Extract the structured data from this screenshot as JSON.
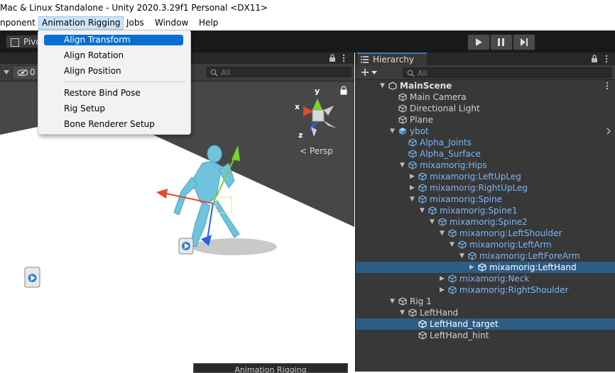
{
  "window": {
    "title": "Mac & Linux Standalone - Unity 2020.3.29f1 Personal <DX11>"
  },
  "menubar": {
    "items": [
      {
        "label": "nponent"
      },
      {
        "label": "Animation Rigging"
      },
      {
        "label": "Jobs"
      },
      {
        "label": "Window"
      },
      {
        "label": "Help"
      }
    ]
  },
  "toolbar": {
    "pivot_label": "Pivo"
  },
  "scene": {
    "layers_count": "0",
    "search_placeholder": "All",
    "persp_label": "Persp",
    "gizmo_axes": {
      "x": "x",
      "y": "y",
      "z": "z"
    }
  },
  "dropdown": {
    "items": [
      {
        "label": "Align Transform"
      },
      {
        "label": "Align Rotation"
      },
      {
        "label": "Align Position"
      },
      {
        "label": "Restore Bind Pose"
      },
      {
        "label": "Rig Setup"
      },
      {
        "label": "Bone Renderer Setup"
      }
    ]
  },
  "hierarchy": {
    "tab_label": "Hierarchy",
    "search_placeholder": "All",
    "rows": [
      {
        "label": "MainScene",
        "depth": 0,
        "arrow": "down",
        "style": "scene",
        "selected": false
      },
      {
        "label": "Main Camera",
        "depth": 1,
        "arrow": "",
        "style": "normal",
        "selected": false
      },
      {
        "label": "Directional Light",
        "depth": 1,
        "arrow": "",
        "style": "normal",
        "selected": false
      },
      {
        "label": "Plane",
        "depth": 1,
        "arrow": "",
        "style": "normal",
        "selected": false
      },
      {
        "label": "ybot",
        "depth": 1,
        "arrow": "down",
        "style": "blue",
        "selected": false
      },
      {
        "label": "Alpha_Joints",
        "depth": 2,
        "arrow": "",
        "style": "blue",
        "selected": false
      },
      {
        "label": "Alpha_Surface",
        "depth": 2,
        "arrow": "",
        "style": "blue",
        "selected": false
      },
      {
        "label": "mixamorig:Hips",
        "depth": 2,
        "arrow": "down",
        "style": "blue",
        "selected": false
      },
      {
        "label": "mixamorig:LeftUpLeg",
        "depth": 3,
        "arrow": "right",
        "style": "blue",
        "selected": false
      },
      {
        "label": "mixamorig:RightUpLeg",
        "depth": 3,
        "arrow": "right",
        "style": "blue",
        "selected": false
      },
      {
        "label": "mixamorig:Spine",
        "depth": 3,
        "arrow": "down",
        "style": "blue",
        "selected": false
      },
      {
        "label": "mixamorig:Spine1",
        "depth": 4,
        "arrow": "down",
        "style": "blue",
        "selected": false
      },
      {
        "label": "mixamorig:Spine2",
        "depth": 5,
        "arrow": "down",
        "style": "blue",
        "selected": false
      },
      {
        "label": "mixamorig:LeftShoulder",
        "depth": 6,
        "arrow": "down",
        "style": "blue",
        "selected": false
      },
      {
        "label": "mixamorig:LeftArm",
        "depth": 7,
        "arrow": "down",
        "style": "blue",
        "selected": false
      },
      {
        "label": "mixamorig:LeftForeArm",
        "depth": 8,
        "arrow": "down",
        "style": "blue",
        "selected": false
      },
      {
        "label": "mixamorig:LeftHand",
        "depth": 9,
        "arrow": "right",
        "style": "blue",
        "selected": true
      },
      {
        "label": "mixamorig:Neck",
        "depth": 6,
        "arrow": "right",
        "style": "blue",
        "selected": false
      },
      {
        "label": "mixamorig:RightShoulder",
        "depth": 6,
        "arrow": "right",
        "style": "blue",
        "selected": false
      },
      {
        "label": "Rig 1",
        "depth": 1,
        "arrow": "down",
        "style": "normal",
        "selected": false
      },
      {
        "label": "LeftHand",
        "depth": 2,
        "arrow": "down",
        "style": "normal",
        "selected": false
      },
      {
        "label": "LeftHand_target",
        "depth": 3,
        "arrow": "",
        "style": "normal",
        "selected": true
      },
      {
        "label": "LeftHand_hint",
        "depth": 3,
        "arrow": "",
        "style": "normal",
        "selected": false
      }
    ]
  },
  "bottom_popup": {
    "label": "Animation Rigging"
  },
  "colors": {
    "selection": "#2c5d87",
    "menu_highlight": "#0a6ed1",
    "prefab_blue": "#7ab8f5"
  }
}
